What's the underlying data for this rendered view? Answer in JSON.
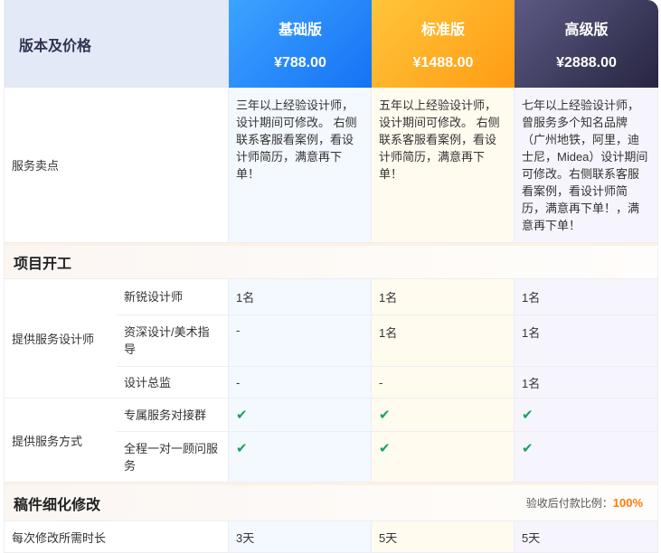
{
  "header": {
    "corner_label": "版本及价格",
    "plans": [
      {
        "name": "基础版",
        "price": "¥788.00"
      },
      {
        "name": "标准版",
        "price": "¥1488.00"
      },
      {
        "name": "高级版",
        "price": "¥2888.00"
      }
    ]
  },
  "selling": {
    "label": "服务卖点",
    "basic": "三年以上经验设计师，设计期间可修改。 右侧联系客服看案例，看设计师简历，满意再下单！",
    "standard": "五年以上经验设计师，设计期间可修改。 右侧联系客服看案例，看设计师简历，满意再下单！",
    "pro": "七年以上经验设计师，曾服务多个知名品牌（广州地铁，阿里，迪士尼，Midea）设计期间可修改。右侧联系客服看案例，看设计师简历，满意再下单！，满意再下单！"
  },
  "section1": {
    "title": "项目开工"
  },
  "designers": {
    "group_label": "提供服务设计师",
    "rows": [
      {
        "label": "新锐设计师",
        "basic": "1名",
        "standard": "1名",
        "pro": "1名"
      },
      {
        "label": "资深设计/美术指导",
        "basic": "-",
        "standard": "1名",
        "pro": "1名"
      },
      {
        "label": "设计总监",
        "basic": "-",
        "standard": "-",
        "pro": "1名"
      }
    ]
  },
  "service_mode": {
    "group_label": "提供服务方式",
    "check_symbol": "✔",
    "rows": [
      {
        "label": "专属服务对接群"
      },
      {
        "label": "全程一对一顾问服务"
      }
    ]
  },
  "section2": {
    "title": "稿件细化修改",
    "note_label": "验收后付款比例：",
    "note_value": "100%"
  },
  "revision": {
    "label": "每次修改所需时长",
    "basic": "3天",
    "standard": "5天",
    "pro": "5天"
  },
  "colors": {
    "accent_orange": "#ff7a00",
    "check_green": "#16a25f",
    "basic_blue": "#1672f5",
    "standard_orange": "#ff9c14",
    "pro_dark": "#272541"
  }
}
